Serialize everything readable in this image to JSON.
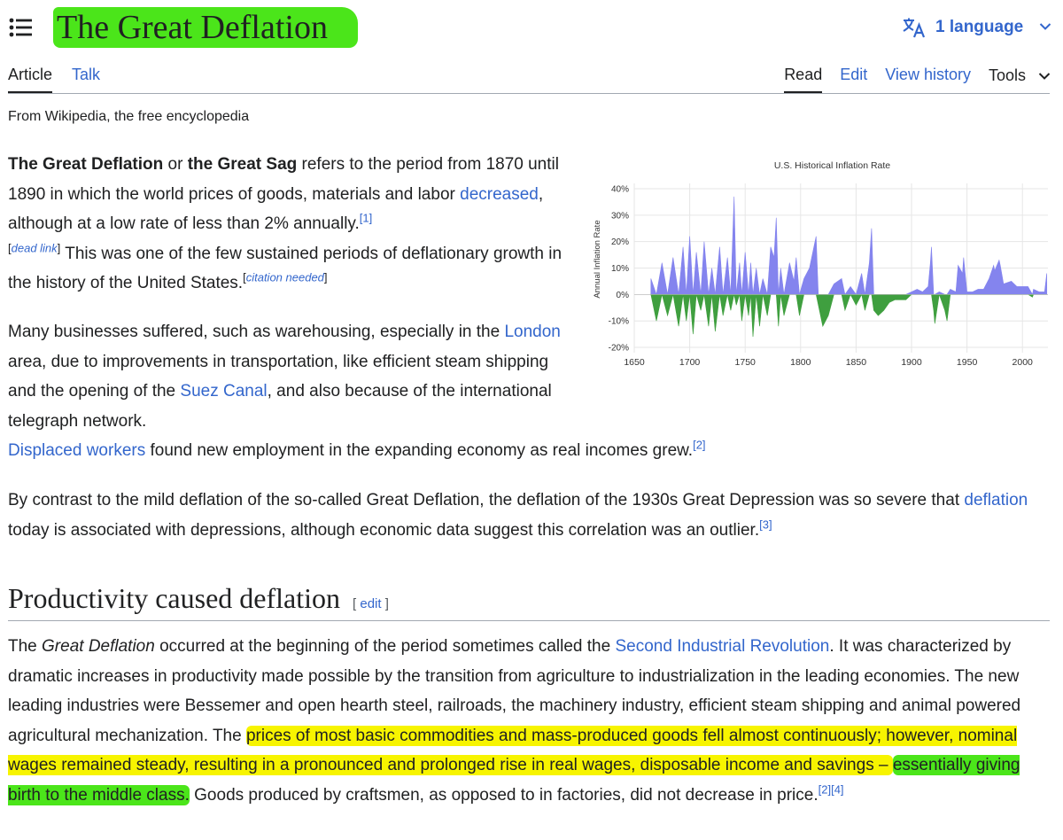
{
  "header": {
    "title": "The Great Deflation",
    "language_label": "1 language",
    "icons": {
      "menu": "hamburger-icon",
      "language": "translate-icon",
      "chevron": "chevron-down-icon"
    }
  },
  "tabs": {
    "left": [
      {
        "label": "Article",
        "selected": true
      },
      {
        "label": "Talk",
        "selected": false
      }
    ],
    "right": [
      {
        "label": "Read",
        "selected": true
      },
      {
        "label": "Edit"
      },
      {
        "label": "View history"
      },
      {
        "label": "Tools"
      }
    ]
  },
  "tagline": "From Wikipedia, the free encyclopedia",
  "p1": {
    "b1": "The Great Deflation",
    "t1": " or ",
    "b2": "the Great Sag",
    "t2": " refers to the period from 1870 until 1890 in which the world prices of goods, materials and labor ",
    "link1": "decreased",
    "t3": ", although at a low rate of less than 2% annually.",
    "ref1": "[1]",
    "dead_open": "[",
    "dead": "dead link",
    "dead_close": "]",
    "t4": " This was one of the few sustained periods of deflationary growth in the history of the United States.",
    "cn_open": "[",
    "cn": "citation needed",
    "cn_close": "]"
  },
  "p2": {
    "t1": "Many businesses suffered, such as warehousing, especially in the ",
    "link1": "London",
    "t2": " area, due to improvements in transportation, like efficient steam shipping and the opening of the ",
    "link2": "Suez Canal",
    "t3": ", and also because of the international telegraph network. ",
    "link3": "Displaced workers",
    "t4": " found new employment in the expanding economy as real incomes grew.",
    "ref": "[2]"
  },
  "p3": {
    "t1": "By contrast to the mild deflation of the so-called Great Deflation, the deflation of the 1930s Great Depression was so severe that ",
    "link1": "deflation",
    "t2": " today is associated with depressions, although economic data suggest this correlation was an outlier.",
    "ref": "[3]"
  },
  "section": {
    "heading": "Productivity caused deflation",
    "edit_open": "[ ",
    "edit": "edit",
    "edit_close": " ]"
  },
  "p4": {
    "t1": "The ",
    "i1": "Great Deflation",
    "t2": " occurred at the beginning of the period sometimes called the ",
    "link1": "Second Industrial Revolution",
    "t3": ". It was characterized by dramatic increases in productivity made possible by the transition from agriculture to industrialization in the leading economies. The new leading industries were Bessemer and open hearth steel, railroads, the machinery industry, efficient steam shipping and animal powered agricultural mechanization. The ",
    "hl_yellow": "prices of most basic commodities and mass-produced goods fell almost continuously; however, nominal wages remained steady, resulting in a pronounced and prolonged rise in real wages, disposable income and savings – ",
    "hl_green": "essentially giving birth to the middle class.",
    "t4": " Goods produced by craftsmen, as opposed to in factories, did not decrease in price.",
    "ref1": "[2]",
    "ref2": "[4]"
  },
  "chart_data": {
    "type": "area",
    "title": "U.S. Historical Inflation Rate",
    "ylabel": "Annual Inflation Rate",
    "xlabel": "",
    "xlim": [
      1650,
      2023
    ],
    "ylim": [
      -22,
      42
    ],
    "x_ticks": [
      1650,
      1700,
      1750,
      1800,
      1850,
      1900,
      1950,
      2000
    ],
    "y_ticks": [
      -20,
      -10,
      0,
      10,
      20,
      30,
      40
    ],
    "y_tick_labels": [
      "-20%",
      "-10%",
      "0%",
      "10%",
      "20%",
      "30%",
      "40%"
    ],
    "grid": true,
    "colors": {
      "positive": "#8484ee",
      "negative": "#3f9f3f"
    },
    "series_x": [
      1665,
      1670,
      1675,
      1680,
      1685,
      1690,
      1694,
      1697,
      1700,
      1703,
      1706,
      1710,
      1713,
      1717,
      1720,
      1723,
      1727,
      1730,
      1734,
      1737,
      1740,
      1742,
      1745,
      1747,
      1750,
      1753,
      1755,
      1757,
      1760,
      1763,
      1766,
      1770,
      1773,
      1776,
      1778,
      1780,
      1782,
      1785,
      1790,
      1794,
      1796,
      1799,
      1803,
      1808,
      1812,
      1814,
      1816,
      1820,
      1825,
      1830,
      1837,
      1840,
      1845,
      1850,
      1855,
      1858,
      1862,
      1864,
      1866,
      1870,
      1875,
      1880,
      1885,
      1890,
      1895,
      1900,
      1905,
      1910,
      1915,
      1917,
      1918,
      1920,
      1921,
      1925,
      1930,
      1932,
      1935,
      1940,
      1942,
      1946,
      1947,
      1950,
      1955,
      1960,
      1965,
      1970,
      1974,
      1975,
      1979,
      1980,
      1983,
      1990,
      1995,
      2000,
      2005,
      2009,
      2010,
      2015,
      2020,
      2022
    ],
    "series_y": [
      6,
      -10,
      12,
      -8,
      14,
      -12,
      18,
      -10,
      22,
      -15,
      16,
      -6,
      20,
      -12,
      10,
      -14,
      18,
      -8,
      14,
      -6,
      37,
      -4,
      12,
      -10,
      16,
      -8,
      12,
      -16,
      10,
      -12,
      6,
      -8,
      18,
      14,
      29,
      -12,
      10,
      -8,
      12,
      5,
      14,
      -8,
      6,
      10,
      18,
      22,
      -4,
      -12,
      -8,
      4,
      6,
      -6,
      3,
      -4,
      8,
      -6,
      12,
      25,
      -6,
      -8,
      -6,
      -3,
      -2,
      -2,
      -2,
      1,
      2,
      1,
      3,
      12,
      18,
      -6,
      -11,
      1,
      -6,
      -10,
      2,
      1,
      11,
      8,
      14,
      1,
      1,
      2,
      2,
      6,
      11,
      9,
      13,
      11,
      4,
      5,
      3,
      3,
      3,
      -1,
      2,
      1,
      1,
      8
    ]
  }
}
